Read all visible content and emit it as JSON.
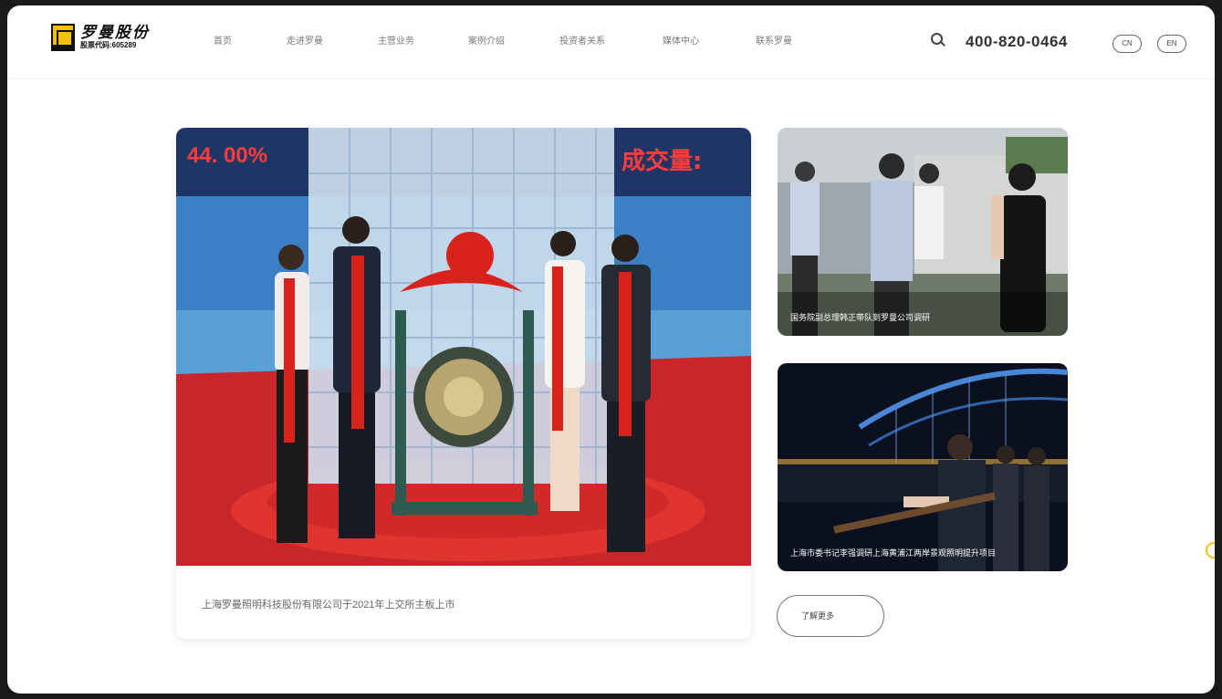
{
  "brand": {
    "name": "罗曼股份",
    "stock_code": "股票代码:605289"
  },
  "nav": {
    "items": [
      "首页",
      "走进罗曼",
      "主营业务",
      "案例介绍",
      "投资者关系",
      "媒体中心",
      "联系罗曼"
    ]
  },
  "header": {
    "phone": "400-820-0464",
    "lang_cn": "CN",
    "lang_en": "EN"
  },
  "featured": {
    "overlay_left": "44. 00%",
    "overlay_right": "成交量:",
    "caption": "上海罗曼照明科技股份有限公司于2021年上交所主板上市"
  },
  "side_news": [
    {
      "caption": "国务院副总理韩正带队到罗曼公司调研"
    },
    {
      "caption": "上海市委书记李强调研上海黄浦江两岸景观照明提升项目"
    }
  ],
  "more_button": "了解更多",
  "colors": {
    "brand_yellow": "#f4c20d",
    "ribbon_red": "#d8231d"
  }
}
